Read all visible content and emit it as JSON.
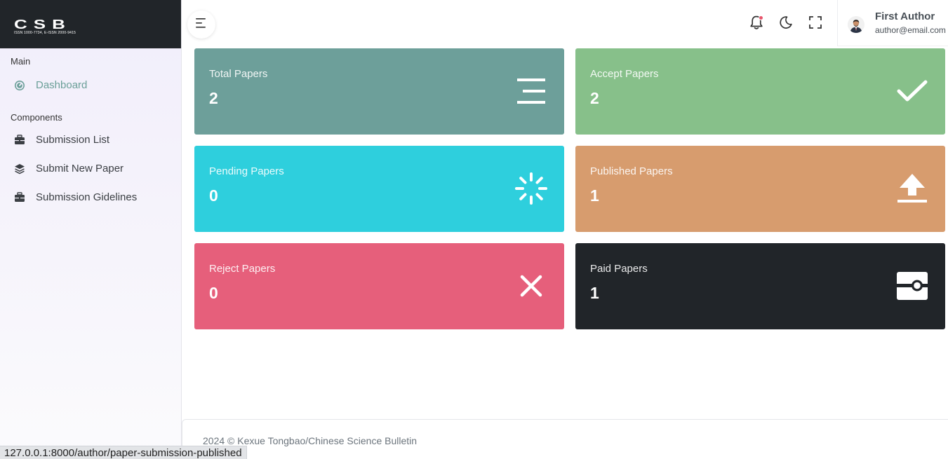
{
  "brand": {
    "logo_text": "CSB",
    "issn": "ISSN 1000-7734, E-ISSN 2000-9415"
  },
  "sidebar": {
    "main_heading": "Main",
    "components_heading": "Components",
    "items": [
      {
        "label": "Dashboard",
        "icon": "gauge-icon",
        "active": true
      },
      {
        "label": "Submission List",
        "icon": "briefcase-icon"
      },
      {
        "label": "Submit New Paper",
        "icon": "layers-icon"
      },
      {
        "label": "Submission Gidelines",
        "icon": "briefcase-icon"
      }
    ]
  },
  "header": {
    "user_name": "First Author",
    "user_email": "author@email.com"
  },
  "cards": [
    {
      "label": "Total Papers",
      "value": "2",
      "color": "#6d9f9a",
      "icon": "list-icon"
    },
    {
      "label": "Accept Papers",
      "value": "2",
      "color": "#87c08a",
      "icon": "check-icon"
    },
    {
      "label": "Pending Papers",
      "value": "0",
      "color": "#2ecfdd",
      "icon": "spinner-icon"
    },
    {
      "label": "Published Papers",
      "value": "1",
      "color": "#d79c6e",
      "icon": "upload-icon"
    },
    {
      "label": "Reject Papers",
      "value": "0",
      "color": "#e65f7b",
      "icon": "close-icon"
    },
    {
      "label": "Paid Papers",
      "value": "1",
      "color": "#212529",
      "icon": "wallet-icon"
    }
  ],
  "footer": {
    "text": "2024 © Kexue Tongbao/Chinese Science Bulletin"
  },
  "statusbar": {
    "url": "127.0.0.1:8000/author/paper-submission-published"
  }
}
